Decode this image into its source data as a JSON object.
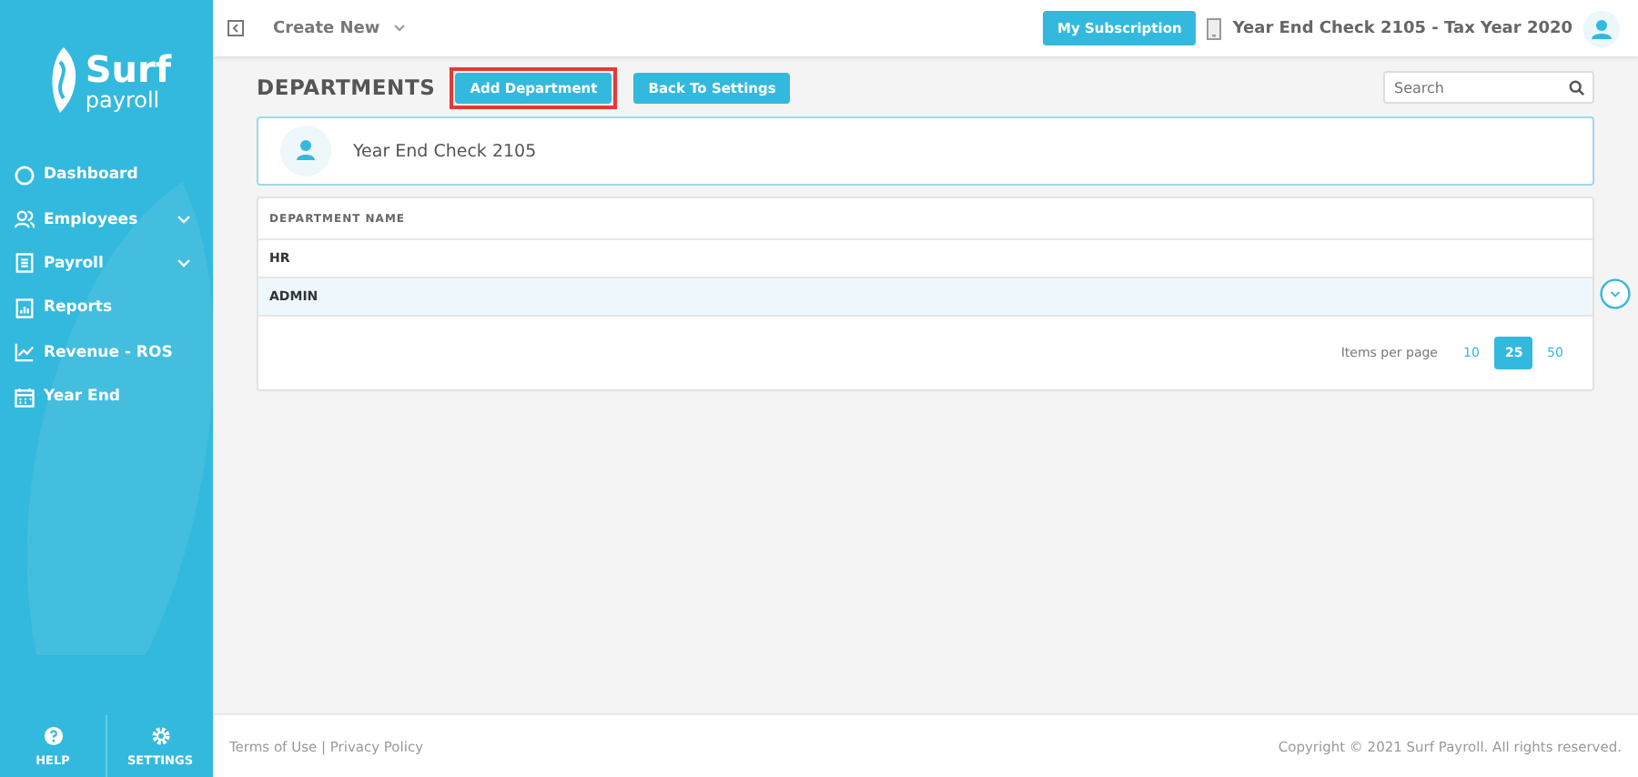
{
  "logo": {
    "name": "Surf",
    "sub": "payroll"
  },
  "sidebar": {
    "items": [
      {
        "label": "Dashboard",
        "has_submenu": false
      },
      {
        "label": "Employees",
        "has_submenu": true
      },
      {
        "label": "Payroll",
        "has_submenu": true
      },
      {
        "label": "Reports",
        "has_submenu": false
      },
      {
        "label": "Revenue - ROS",
        "has_submenu": false
      },
      {
        "label": "Year End",
        "has_submenu": false
      }
    ],
    "bottom": [
      {
        "label": "HELP"
      },
      {
        "label": "SETTINGS"
      }
    ]
  },
  "topbar": {
    "create_new": "Create New",
    "subscription_button": "My Subscription",
    "company": "Year End Check 2105 - Tax Year 2020"
  },
  "page": {
    "title": "DEPARTMENTS",
    "buttons": [
      {
        "label": "Add Department",
        "highlighted": true
      },
      {
        "label": "Back To Settings",
        "highlighted": false
      }
    ],
    "search": {
      "placeholder": "Search"
    }
  },
  "company_card": {
    "name": "Year End Check 2105"
  },
  "table": {
    "columns": [
      "DEPARTMENT NAME"
    ],
    "rows": [
      {
        "name": "HR",
        "selected": false
      },
      {
        "name": "ADMIN",
        "selected": true
      }
    ]
  },
  "pagination": {
    "label": "Items per page",
    "sizes": [
      {
        "label": "10",
        "selected": false
      },
      {
        "label": "25",
        "selected": true
      },
      {
        "label": "50",
        "selected": false
      }
    ]
  },
  "footer": {
    "links": "Terms of Use | Privacy Policy",
    "copyright": "Copyright © 2021 Surf Payroll. All rights reserved."
  }
}
